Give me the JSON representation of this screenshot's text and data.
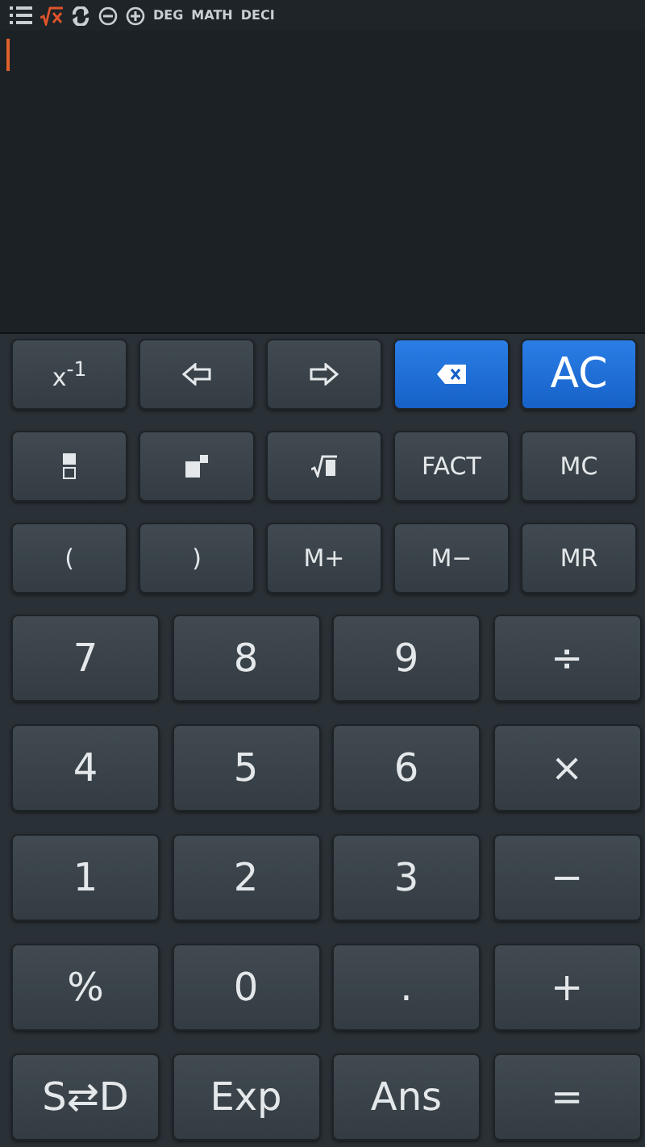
{
  "status_bar": {
    "modes": [
      "DEG",
      "MATH",
      "DECI"
    ]
  },
  "display": {
    "cursor": true
  },
  "small_keys": [
    [
      {
        "kind": "text",
        "label": "x$^{-1}$",
        "highlighted": false
      },
      {
        "kind": "icon",
        "highlighted": false
      },
      {
        "kind": "icon",
        "highlighted": false
      },
      {
        "kind": "icon",
        "highlighted": true
      },
      {
        "kind": "text",
        "label": "AC",
        "highlighted": true
      }
    ],
    [
      {
        "kind": "icon",
        "highlighted": false
      },
      {
        "kind": "icon",
        "highlighted": false
      },
      {
        "kind": "icon",
        "highlighted": false
      },
      {
        "kind": "text",
        "label": "FACT",
        "highlighted": false
      },
      {
        "kind": "text",
        "label": "MC",
        "highlighted": false
      }
    ],
    [
      {
        "kind": "text",
        "label": "(",
        "highlighted": false
      },
      {
        "kind": "text",
        "label": ")",
        "highlighted": false
      },
      {
        "kind": "text",
        "label": "M+",
        "highlighted": false
      },
      {
        "kind": "text",
        "label": "M−",
        "highlighted": false
      },
      {
        "kind": "text",
        "label": "MR",
        "highlighted": false
      }
    ]
  ],
  "big_keys": [
    [
      "7",
      "8",
      "9",
      "÷"
    ],
    [
      "4",
      "5",
      "6",
      "×"
    ],
    [
      "1",
      "2",
      "3",
      "−"
    ],
    [
      "%",
      "0",
      ".",
      "+"
    ],
    [
      "S⇄D",
      "Exp",
      "Ans",
      "="
    ]
  ]
}
